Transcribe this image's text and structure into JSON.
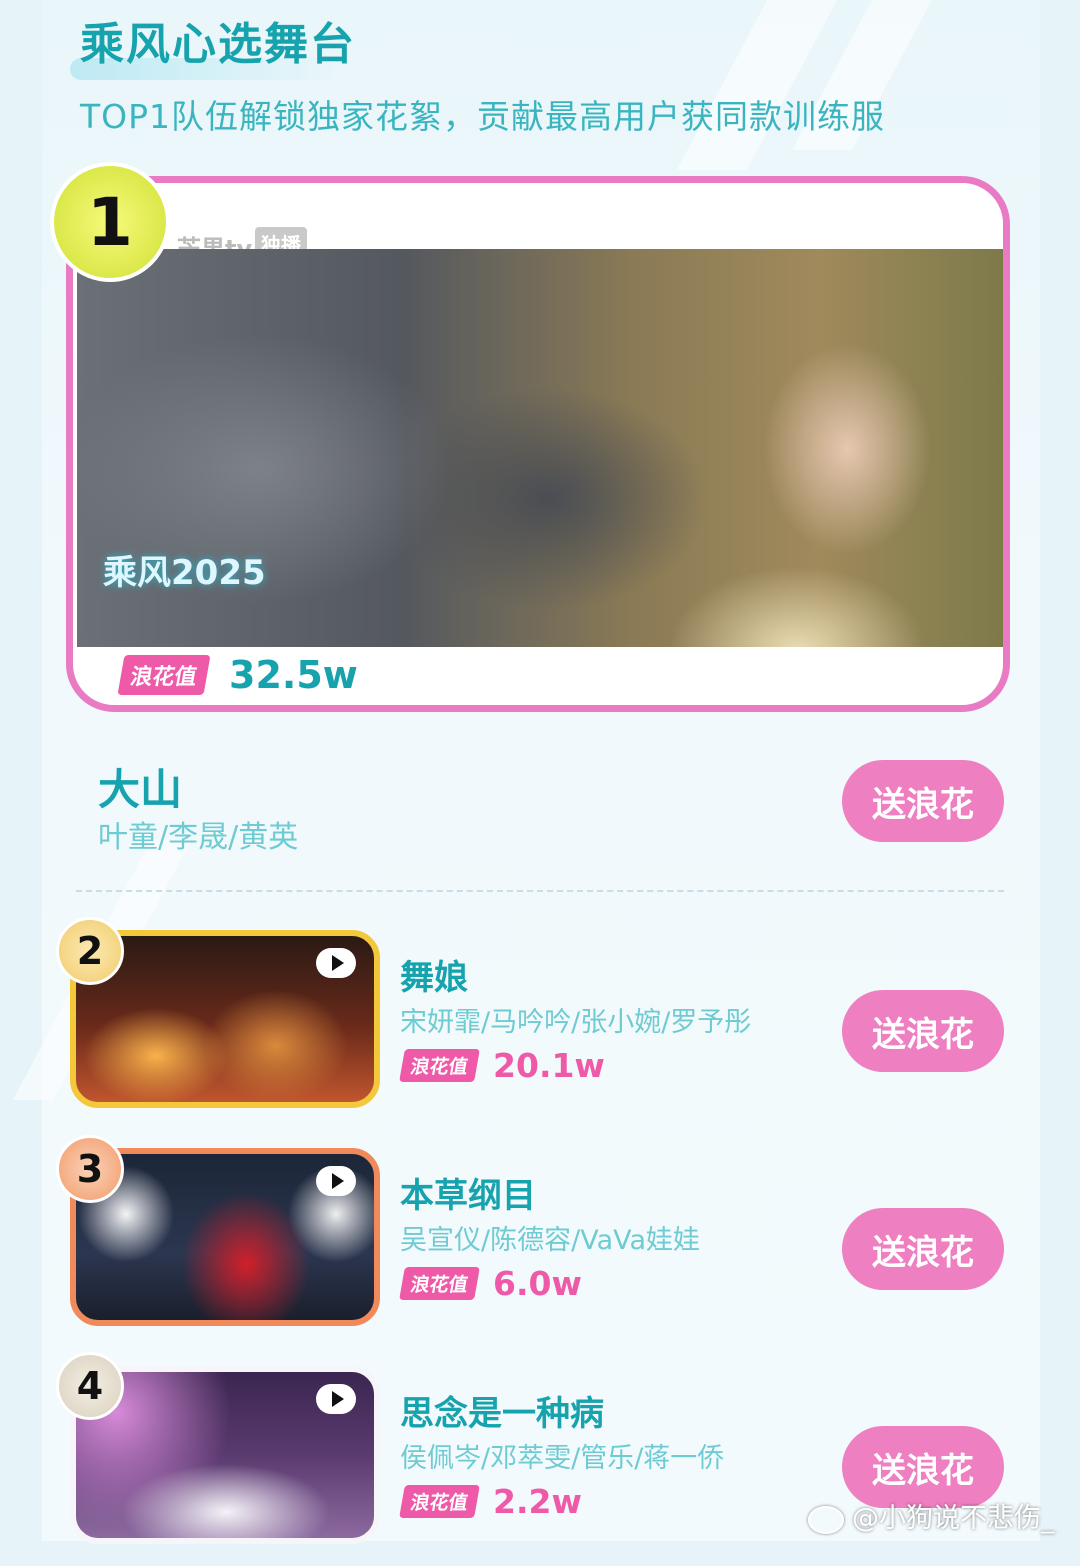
{
  "header": {
    "title": "乘风心选舞台",
    "subtitle": "TOP1队伍解锁独家花絮，贡献最高用户获同款训练服"
  },
  "featured": {
    "rank": "1",
    "channel_logo": "芒果tv",
    "channel_tag": "独播",
    "show_logo": "乘风2025",
    "wave_label": "浪花值",
    "wave_value": "32.5w",
    "song": "大山",
    "artists": "叶童/李晟/黄英",
    "button_label": "送浪花"
  },
  "list": [
    {
      "rank": "2",
      "song": "舞娘",
      "artists": "宋妍霏/马吟吟/张小婉/罗予彤",
      "wave_label": "浪花值",
      "wave_value": "20.1w",
      "button_label": "送浪花"
    },
    {
      "rank": "3",
      "song": "本草纲目",
      "artists": "吴宣仪/陈德容/VaVa娃娃",
      "wave_label": "浪花值",
      "wave_value": "6.0w",
      "button_label": "送浪花"
    },
    {
      "rank": "4",
      "song": "思念是一种病",
      "artists": "侯佩岑/邓萃雯/管乐/蒋一侨",
      "wave_label": "浪花值",
      "wave_value": "2.2w",
      "button_label": "送浪花"
    }
  ],
  "watermark": "@小狗说不悲伤_",
  "colors": {
    "title": "#17a3ad",
    "accent_pink": "#ee5aa8",
    "button": "#ee7fc1",
    "hero_border": "#e97bc4"
  },
  "icons": [
    "play-icon",
    "weibo-icon",
    "rank-medal"
  ]
}
